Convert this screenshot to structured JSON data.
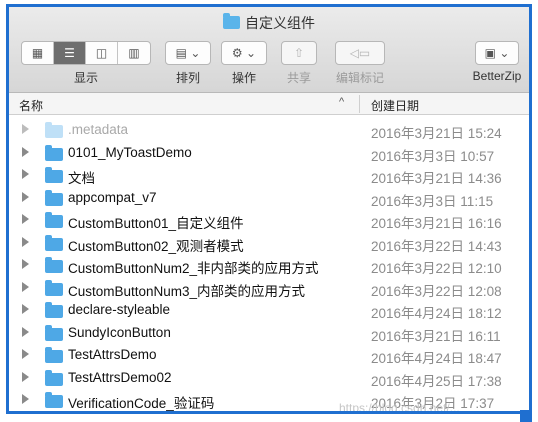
{
  "window": {
    "title": "自定义组件",
    "folder_icon": "folder-icon"
  },
  "toolbar": {
    "view_label": "显示",
    "sort_label": "排列",
    "action_label": "操作",
    "share_label": "共享",
    "edit_tags_label": "编辑标记",
    "betterzip_label": "BetterZip",
    "view_modes": [
      "icon-view-icon",
      "list-view-icon",
      "column-view-icon",
      "cover-flow-icon"
    ],
    "active_view": "list-view-icon"
  },
  "columns": {
    "name": "名称",
    "date": "创建日期",
    "sort_indicator": "^"
  },
  "files": [
    {
      "name": ".metadata",
      "date": "2016年3月21日 15:24",
      "dimmed": true
    },
    {
      "name": "0101_MyToastDemo",
      "date": "2016年3月3日 10:57"
    },
    {
      "name": "文档",
      "date": "2016年3月21日 14:36"
    },
    {
      "name": "appcompat_v7",
      "date": "2016年3月3日 11:15"
    },
    {
      "name": "CustomButton01_自定义组件",
      "date": "2016年3月21日 16:16"
    },
    {
      "name": "CustomButton02_观测者模式",
      "date": "2016年3月22日 14:43"
    },
    {
      "name": "CustomButtonNum2_非内部类的应用方式",
      "date": "2016年3月22日 12:10"
    },
    {
      "name": "CustomButtonNum3_内部类的应用方式",
      "date": "2016年3月22日 12:08"
    },
    {
      "name": "declare-styleable",
      "date": "2016年4月24日 18:12"
    },
    {
      "name": "SundyIconButton",
      "date": "2016年3月21日 16:11"
    },
    {
      "name": "TestAttrsDemo",
      "date": "2016年4月24日 18:47"
    },
    {
      "name": "TestAttrsDemo02",
      "date": "2016年4月25日 17:38"
    },
    {
      "name": "VerificationCode_验证码",
      "date": "2016年3月2日 17:37"
    }
  ],
  "watermark": "https://blog.csdn.net/...",
  "colors": {
    "frame": "#1f6fd0",
    "folder": "#4ea8e6"
  }
}
